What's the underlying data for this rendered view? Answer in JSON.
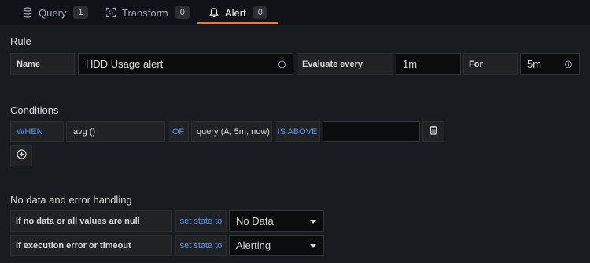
{
  "tabs": [
    {
      "label": "Query",
      "count": "1",
      "icon": "database-icon"
    },
    {
      "label": "Transform",
      "count": "0",
      "icon": "transform-icon"
    },
    {
      "label": "Alert",
      "count": "0",
      "icon": "bell-icon"
    }
  ],
  "accent_color": "#ee7a35",
  "keyword_color": "#5794f2",
  "rule": {
    "title": "Rule",
    "name_label": "Name",
    "name_value": "HDD Usage alert",
    "evaluate_label": "Evaluate every",
    "evaluate_value": "1m",
    "for_label": "For",
    "for_value": "5m"
  },
  "conditions": {
    "title": "Conditions",
    "when": "WHEN",
    "func": "avg ()",
    "of": "OF",
    "query": "query (A, 5m, now)",
    "is_above": "IS ABOVE",
    "threshold_value": ""
  },
  "nodata": {
    "title": "No data and error handling",
    "row1_label": "If no data or all values are null",
    "row1_action": "set state to",
    "row1_value": "No Data",
    "row2_label": "If execution error or timeout",
    "row2_action": "set state to",
    "row2_value": "Alerting"
  }
}
